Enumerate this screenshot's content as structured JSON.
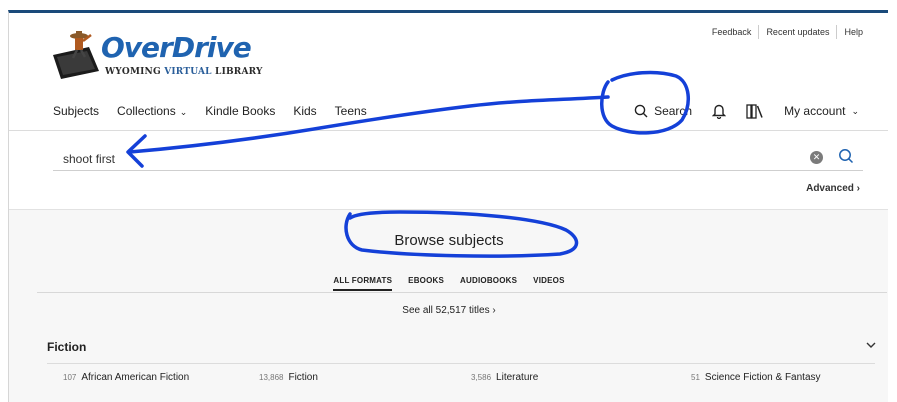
{
  "logo": {
    "wordmark": "OverDrive",
    "tagline_part1": "WYOMING ",
    "tagline_part2": "VIRTUAL",
    "tagline_part3": " LIBRARY"
  },
  "utility_links": [
    "Feedback",
    "Recent updates",
    "Help"
  ],
  "nav": {
    "subjects": "Subjects",
    "collections": "Collections",
    "kindle": "Kindle Books",
    "kids": "Kids",
    "teens": "Teens",
    "search": "Search",
    "account": "My account"
  },
  "search": {
    "value": "shoot first",
    "advanced": "Advanced ›"
  },
  "browse": {
    "title": "Browse subjects",
    "formats": [
      "ALL FORMATS",
      "EBOOKS",
      "AUDIOBOOKS",
      "VIDEOS"
    ],
    "see_all": "See all 52,517 titles ›",
    "section": "Fiction",
    "subjects": [
      {
        "count": "107",
        "label": "African American Fiction"
      },
      {
        "count": "13,868",
        "label": "Fiction"
      },
      {
        "count": "3,586",
        "label": "Literature"
      },
      {
        "count": "51",
        "label": "Science Fiction & Fantasy"
      }
    ]
  },
  "colors": {
    "brand_blue": "#1f63b0",
    "annotation_blue": "#1440d8",
    "header_rule": "#1a4a7a"
  }
}
